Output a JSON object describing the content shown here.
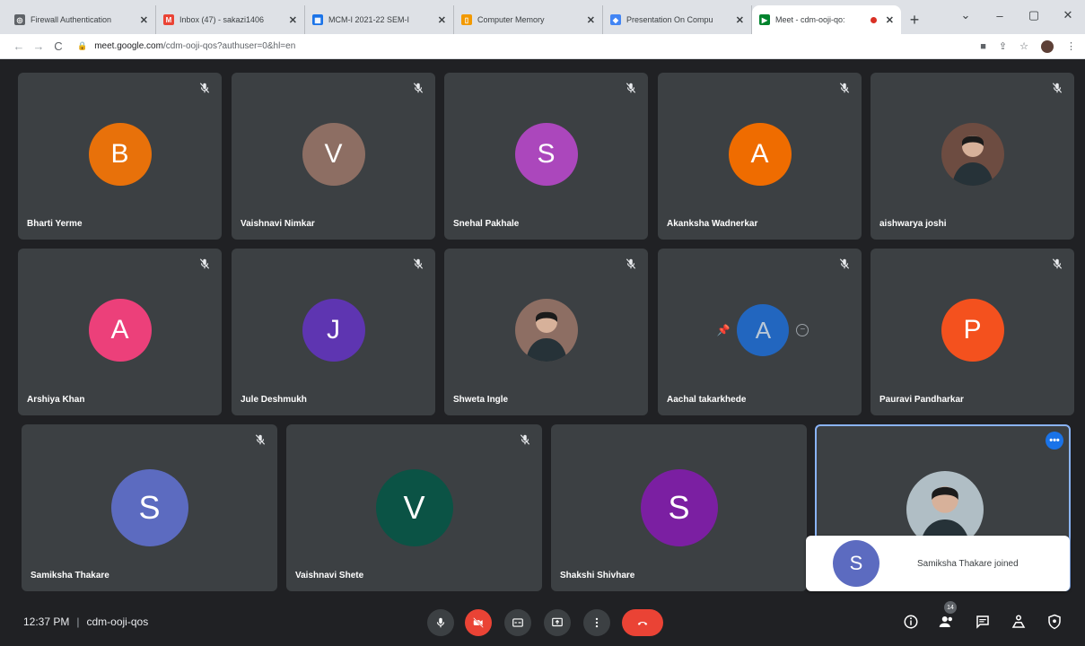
{
  "browser": {
    "tabs": [
      {
        "title": "Firewall Authentication",
        "fav_color": "#5f6368",
        "fav_glyph": "◎"
      },
      {
        "title": "Inbox (47) - sakazi1406",
        "fav_color": "#ea4335",
        "fav_glyph": "M"
      },
      {
        "title": "MCM-I 2021-22 SEM-I",
        "fav_color": "#1a73e8",
        "fav_glyph": "▦"
      },
      {
        "title": "Computer Memory",
        "fav_color": "#f29900",
        "fav_glyph": "▯"
      },
      {
        "title": "Presentation On Compu",
        "fav_color": "#4285f4",
        "fav_glyph": "◆"
      },
      {
        "title": "Meet - cdm-ooji-qo:",
        "fav_color": "#00832d",
        "fav_glyph": "▶"
      }
    ],
    "new_tab": "+",
    "window_controls": [
      "⌄",
      "–",
      "▢",
      "✕"
    ],
    "url_host": "meet.google.com",
    "url_path": "/cdm-ooji-qos?authuser=0&hl=en"
  },
  "participants": [
    {
      "name": "Bharti Yerme",
      "initial": "B",
      "color": "#e8710a",
      "muted": true
    },
    {
      "name": "Vaishnavi Nimkar",
      "initial": "V",
      "color": "#8d6e63",
      "muted": true
    },
    {
      "name": "Snehal Pakhale",
      "initial": "S",
      "color": "#ab47bc",
      "muted": true
    },
    {
      "name": "Akanksha Wadnerkar",
      "initial": "A",
      "color": "#ef6c00",
      "muted": true
    },
    {
      "name": "aishwarya joshi",
      "initial": "",
      "color": "#6d4c41",
      "muted": true,
      "photo": true
    },
    {
      "name": "Arshiya Khan",
      "initial": "A",
      "color": "#ec407a",
      "muted": true
    },
    {
      "name": "Jule Deshmukh",
      "initial": "J",
      "color": "#5e35b1",
      "muted": true
    },
    {
      "name": "Shweta Ingle",
      "initial": "",
      "color": "#8d6e63",
      "muted": true,
      "photo": true
    },
    {
      "name": "Aachal takarkhede",
      "initial": "A",
      "color": "#1a73e8",
      "muted": true,
      "hover": true
    },
    {
      "name": "Pauravi Pandharkar",
      "initial": "P",
      "color": "#f4511e",
      "muted": true
    },
    {
      "name": "Samiksha Thakare",
      "initial": "S",
      "color": "#5c6bc0",
      "muted": true
    },
    {
      "name": "Vaishnavi Shete",
      "initial": "V",
      "color": "#0b5345",
      "muted": true
    },
    {
      "name": "Shakshi Shivhare",
      "initial": "S",
      "color": "#7b1fa2",
      "muted": false
    },
    {
      "name": "",
      "initial": "",
      "color": "#b0bec5",
      "muted": false,
      "photo": true,
      "selected": true
    }
  ],
  "toast": {
    "initial": "S",
    "text": "Samiksha Thakare joined"
  },
  "bottom": {
    "time": "12:37 PM",
    "separator": "|",
    "meeting_code": "cdm-ooji-qos",
    "participant_count": "14"
  }
}
